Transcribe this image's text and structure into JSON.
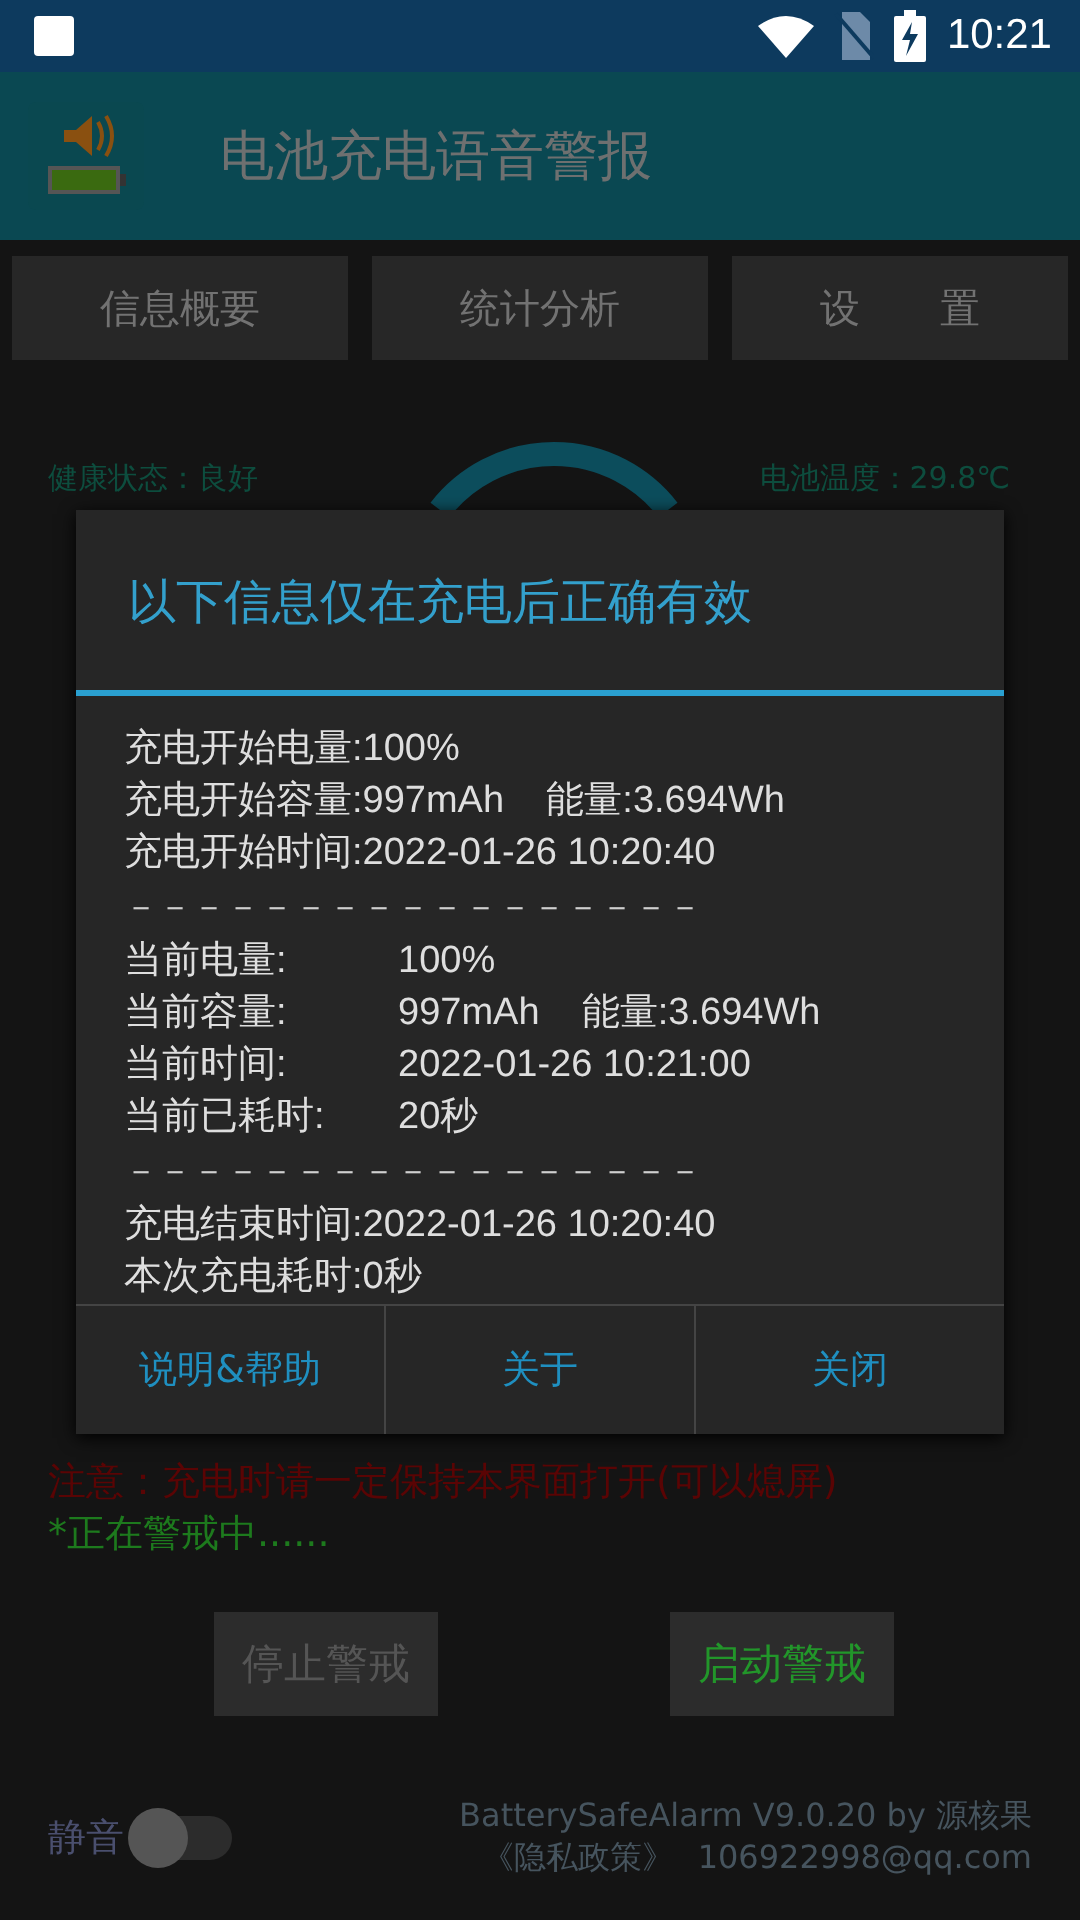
{
  "status_bar": {
    "time": "10:21"
  },
  "app_bar": {
    "title": "电池充电语音警报"
  },
  "tabs": [
    {
      "label": "信息概要",
      "selected": false
    },
    {
      "label": "统计分析",
      "selected": false
    },
    {
      "label": "设　　置",
      "selected": false
    }
  ],
  "info": {
    "health": "健康状态：良好",
    "temperature": "电池温度：29.8℃"
  },
  "dialog": {
    "title": "以下信息仅在充电后正确有效",
    "lines": [
      {
        "kind": "text",
        "text": "充电开始电量:100%"
      },
      {
        "kind": "text",
        "text": "充电开始容量:997mAh    能量:3.694Wh"
      },
      {
        "kind": "text",
        "text": "充电开始时间:2022-01-26 10:20:40"
      },
      {
        "kind": "rule",
        "text": "－－－－－－－－－－－－－－－－－"
      },
      {
        "kind": "pair",
        "label": "当前电量:",
        "value": "100%"
      },
      {
        "kind": "pair",
        "label": "当前容量:",
        "value": "997mAh    能量:3.694Wh"
      },
      {
        "kind": "pair",
        "label": "当前时间:",
        "value": "2022-01-26 10:21:00"
      },
      {
        "kind": "pair",
        "label": "当前已耗时:",
        "value": "20秒"
      },
      {
        "kind": "rule",
        "text": "－－－－－－－－－－－－－－－－－"
      },
      {
        "kind": "text",
        "text": "充电结束时间:2022-01-26 10:20:40"
      },
      {
        "kind": "text",
        "text": "本次充电耗时:0秒"
      }
    ],
    "buttons": [
      "说明&帮助",
      "关于",
      "关闭"
    ]
  },
  "notice": "注意：充电时请一定保持本界面打开(可以熄屏)",
  "alarm_status": "*正在警戒中......",
  "actions": [
    {
      "label": "停止警戒",
      "disabled": true
    },
    {
      "label": "启动警戒",
      "disabled": false
    }
  ],
  "mute": {
    "label": "静音",
    "on": false
  },
  "footer": {
    "version": "BatterySafeAlarm V9.0.20 by 源核果",
    "privacy": "《隐私政策》",
    "email": "106922998@qq.com"
  }
}
